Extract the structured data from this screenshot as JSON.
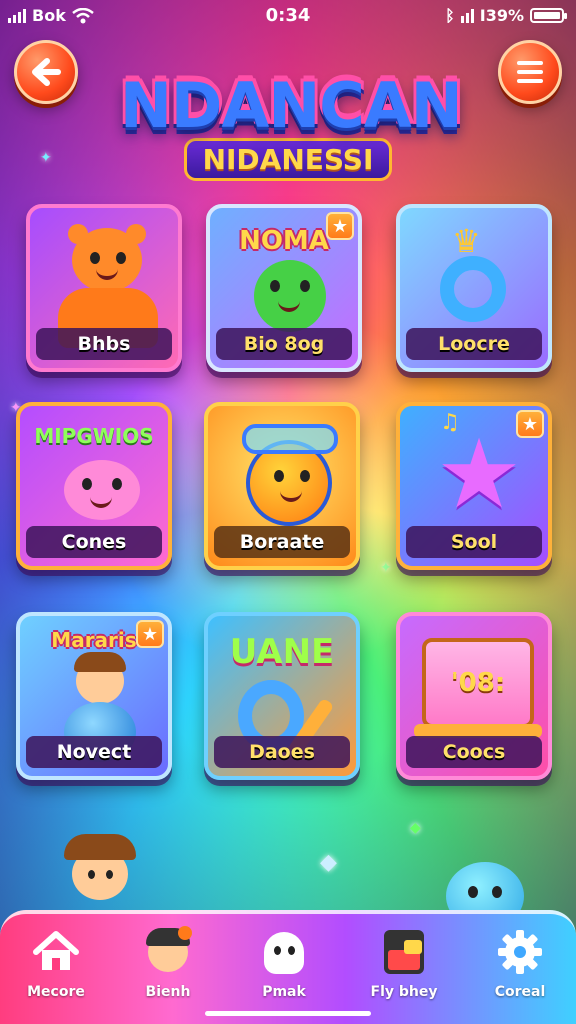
{
  "status_bar": {
    "carrier": "Bok",
    "time": "0:34",
    "battery": "I39%"
  },
  "header": {
    "title": "NDANCAN",
    "subtitle": "NIDANESSI"
  },
  "cards": [
    {
      "label": "Bhbs",
      "art_text": ""
    },
    {
      "label": "Bio 8og",
      "art_text": "NOMA"
    },
    {
      "label": "Loocre",
      "art_text": ""
    },
    {
      "label": "Cones",
      "art_text": "MIPGWIOS"
    },
    {
      "label": "Boraate",
      "art_text": ""
    },
    {
      "label": "Sool",
      "art_text": ""
    },
    {
      "label": "Novect",
      "art_text": "Mararis"
    },
    {
      "label": "Daoes",
      "art_text": "UANE"
    },
    {
      "label": "Coocs",
      "art_text": "'08:"
    }
  ],
  "nav": {
    "items": [
      {
        "label": "Mecore",
        "icon": "home-icon"
      },
      {
        "label": "Bienh",
        "icon": "character-icon"
      },
      {
        "label": "Pmak",
        "icon": "ghost-icon"
      },
      {
        "label": "Fly bhey",
        "icon": "shop-icon"
      },
      {
        "label": "Coreal",
        "icon": "gear-icon"
      }
    ]
  },
  "colors": {
    "accent_orange": "#ff4a1c",
    "title_gold": "#ffd84a",
    "nav_pink": "#ff3d7f",
    "nav_blue": "#3fd0ff"
  }
}
